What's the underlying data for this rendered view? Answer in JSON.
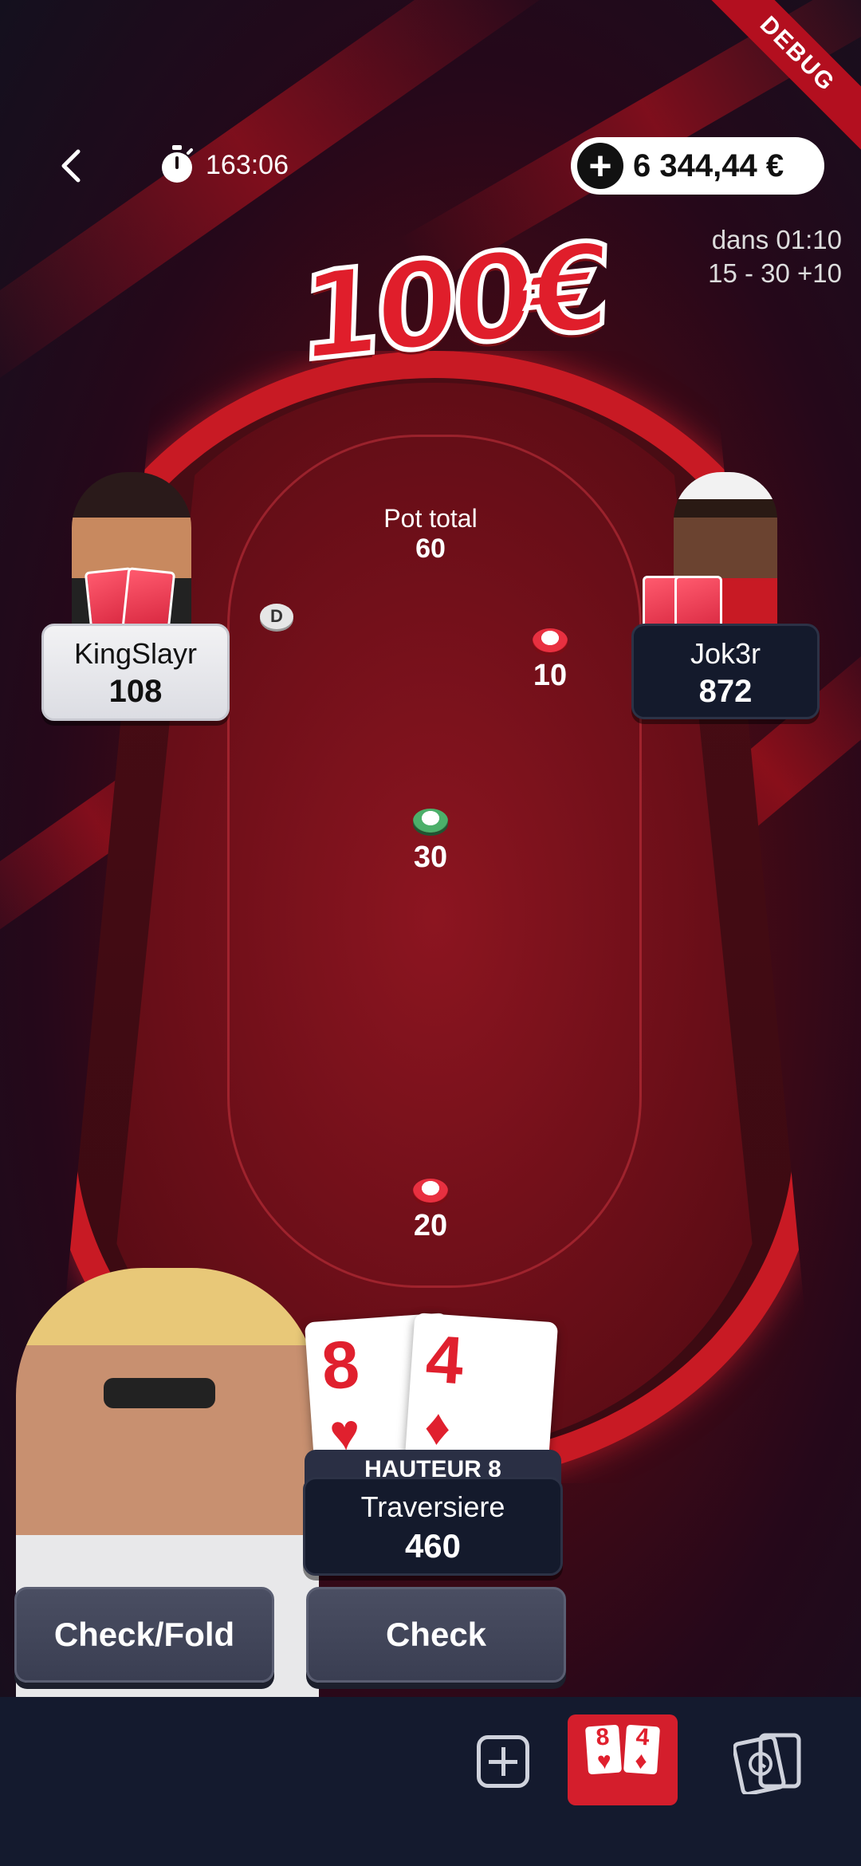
{
  "debug_ribbon": "DEBUG",
  "header": {
    "timer": "163:06",
    "balance": "6 344,44 €"
  },
  "blinds": {
    "next_in": "dans 01:10",
    "levels": "15 - 30 +10"
  },
  "prize": "100€",
  "pot": {
    "label": "Pot total",
    "value": "60"
  },
  "bets": {
    "top_right": "10",
    "center": "30",
    "hero": "20"
  },
  "dealer_button": "D",
  "players": {
    "left": {
      "name": "KingSlayr",
      "stack": "108"
    },
    "right": {
      "name": "Jok3r",
      "stack": "872"
    },
    "hero": {
      "name": "Traversiere",
      "stack": "460",
      "hand_label": "HAUTEUR 8"
    }
  },
  "hero_cards": [
    {
      "rank": "8",
      "suit": "♥"
    },
    {
      "rank": "4",
      "suit": "♦"
    }
  ],
  "actions": {
    "check_fold": "Check/Fold",
    "check": "Check"
  },
  "bottom_bar": {
    "hand_mini": [
      {
        "rank": "8",
        "suit": "♥"
      },
      {
        "rank": "4",
        "suit": "♦"
      }
    ]
  },
  "colors": {
    "accent": "#d41e2c",
    "felt": "#7a0f1a",
    "navy": "#141a2e"
  }
}
